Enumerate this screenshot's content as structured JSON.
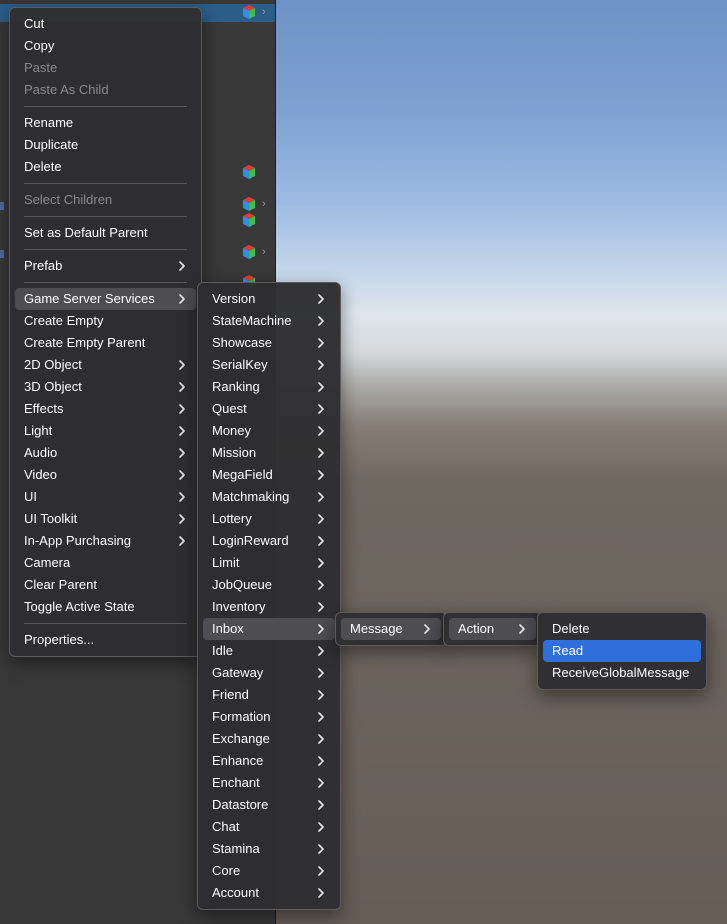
{
  "colors": {
    "highlight": "#2f6fdb",
    "menu_bg": "#2e2e31",
    "hierarchy_bg": "#383838"
  },
  "context_menu": {
    "groups": [
      [
        {
          "label": "Cut",
          "enabled": true
        },
        {
          "label": "Copy",
          "enabled": true
        },
        {
          "label": "Paste",
          "enabled": false
        },
        {
          "label": "Paste As Child",
          "enabled": false
        }
      ],
      [
        {
          "label": "Rename",
          "enabled": true
        },
        {
          "label": "Duplicate",
          "enabled": true
        },
        {
          "label": "Delete",
          "enabled": true
        }
      ],
      [
        {
          "label": "Select Children",
          "enabled": false
        }
      ],
      [
        {
          "label": "Set as Default Parent",
          "enabled": true
        }
      ],
      [
        {
          "label": "Prefab",
          "enabled": true,
          "submenu": true
        }
      ],
      [
        {
          "label": "Game Server Services",
          "enabled": true,
          "submenu": true,
          "state": "hover"
        },
        {
          "label": "Create Empty",
          "enabled": true
        },
        {
          "label": "Create Empty Parent",
          "enabled": true
        },
        {
          "label": "2D Object",
          "enabled": true,
          "submenu": true
        },
        {
          "label": "3D Object",
          "enabled": true,
          "submenu": true
        },
        {
          "label": "Effects",
          "enabled": true,
          "submenu": true
        },
        {
          "label": "Light",
          "enabled": true,
          "submenu": true
        },
        {
          "label": "Audio",
          "enabled": true,
          "submenu": true
        },
        {
          "label": "Video",
          "enabled": true,
          "submenu": true
        },
        {
          "label": "UI",
          "enabled": true,
          "submenu": true
        },
        {
          "label": "UI Toolkit",
          "enabled": true,
          "submenu": true
        },
        {
          "label": "In-App Purchasing",
          "enabled": true,
          "submenu": true
        },
        {
          "label": "Camera",
          "enabled": true
        },
        {
          "label": "Clear Parent",
          "enabled": true
        },
        {
          "label": "Toggle Active State",
          "enabled": true
        }
      ],
      [
        {
          "label": "Properties...",
          "enabled": true
        }
      ]
    ]
  },
  "game_server_services_menu": {
    "items": [
      {
        "label": "Version"
      },
      {
        "label": "StateMachine"
      },
      {
        "label": "Showcase"
      },
      {
        "label": "SerialKey"
      },
      {
        "label": "Ranking"
      },
      {
        "label": "Quest"
      },
      {
        "label": "Money"
      },
      {
        "label": "Mission"
      },
      {
        "label": "MegaField"
      },
      {
        "label": "Matchmaking"
      },
      {
        "label": "Lottery"
      },
      {
        "label": "LoginReward"
      },
      {
        "label": "Limit"
      },
      {
        "label": "JobQueue"
      },
      {
        "label": "Inventory"
      },
      {
        "label": "Inbox",
        "state": "hover"
      },
      {
        "label": "Idle"
      },
      {
        "label": "Gateway"
      },
      {
        "label": "Friend"
      },
      {
        "label": "Formation"
      },
      {
        "label": "Exchange"
      },
      {
        "label": "Enhance"
      },
      {
        "label": "Enchant"
      },
      {
        "label": "Datastore"
      },
      {
        "label": "Chat"
      },
      {
        "label": "Stamina"
      },
      {
        "label": "Core"
      },
      {
        "label": "Account"
      }
    ]
  },
  "inbox_menu": {
    "items": [
      {
        "label": "Message",
        "state": "hover"
      }
    ]
  },
  "message_menu": {
    "items": [
      {
        "label": "Action",
        "state": "hover"
      }
    ]
  },
  "action_menu": {
    "items": [
      {
        "label": "Delete"
      },
      {
        "label": "Read",
        "state": "active"
      },
      {
        "label": "ReceiveGlobalMessage"
      }
    ]
  }
}
